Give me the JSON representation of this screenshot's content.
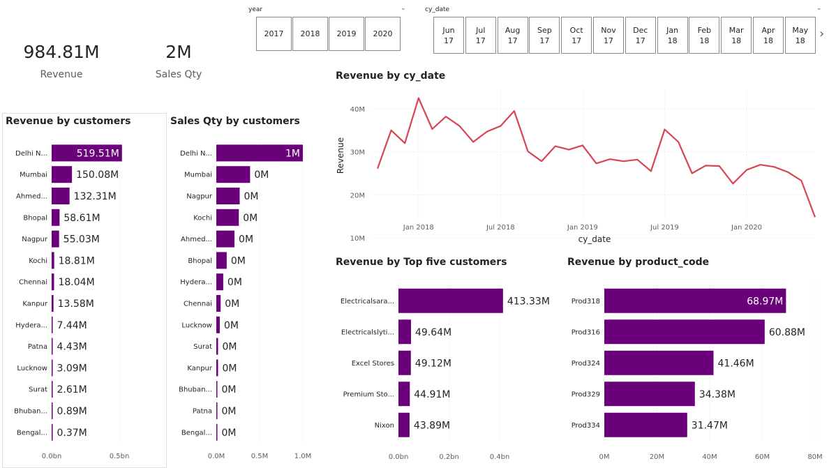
{
  "kpis": [
    {
      "value": "984.81M",
      "label": "Revenue"
    },
    {
      "value": "2M",
      "label": "Sales Qty"
    }
  ],
  "year_slicer": {
    "title": "year",
    "options": [
      "2017",
      "2018",
      "2019",
      "2020"
    ]
  },
  "date_slicer": {
    "title": "cy_date",
    "options": [
      {
        "m": "Jun",
        "y": "17"
      },
      {
        "m": "Jul",
        "y": "17"
      },
      {
        "m": "Aug",
        "y": "17"
      },
      {
        "m": "Sep",
        "y": "17"
      },
      {
        "m": "Oct",
        "y": "17"
      },
      {
        "m": "Nov",
        "y": "17"
      },
      {
        "m": "Dec",
        "y": "17"
      },
      {
        "m": "Jan",
        "y": "18"
      },
      {
        "m": "Feb",
        "y": "18"
      },
      {
        "m": "Mar",
        "y": "18"
      },
      {
        "m": "Apr",
        "y": "18"
      },
      {
        "m": "May",
        "y": "18"
      }
    ]
  },
  "colors": {
    "bar": "#6b007b",
    "line": "#d64550",
    "grid": "#e1dfdd",
    "text": "#252423",
    "axis": "#605e5c"
  },
  "chart_data": [
    {
      "id": "rev_customers",
      "type": "bar",
      "orientation": "horizontal",
      "title": "Revenue by customers",
      "categories": [
        "Delhi N...",
        "Mumbai",
        "Ahmed...",
        "Bhopal",
        "Nagpur",
        "Kochi",
        "Chennai",
        "Kanpur",
        "Hydera...",
        "Patna",
        "Lucknow",
        "Surat",
        "Bhuban...",
        "Bengal..."
      ],
      "values": [
        519.51,
        150.08,
        132.31,
        58.61,
        55.03,
        18.81,
        18.04,
        13.58,
        7.44,
        4.43,
        3.09,
        2.61,
        0.89,
        0.37
      ],
      "data_labels": [
        "519.51M",
        "150.08M",
        "132.31M",
        "58.61M",
        "55.03M",
        "18.81M",
        "18.04M",
        "13.58M",
        "7.44M",
        "4.43M",
        "3.09M",
        "2.61M",
        "0.89M",
        "0.37M"
      ],
      "value_unit": "M",
      "xlim": [
        0,
        500
      ],
      "x_ticks": [
        "0.0bn",
        "0.5bn"
      ],
      "grid": true
    },
    {
      "id": "qty_customers",
      "type": "bar",
      "orientation": "horizontal",
      "title": "Sales Qty by customers",
      "categories": [
        "Delhi N...",
        "Mumbai",
        "Nagpur",
        "Kochi",
        "Ahmed...",
        "Bhopal",
        "Hydera...",
        "Chennai",
        "Lucknow",
        "Surat",
        "Kanpur",
        "Bhuban...",
        "Patna",
        "Bengal..."
      ],
      "values": [
        1.0,
        0.39,
        0.27,
        0.26,
        0.21,
        0.12,
        0.08,
        0.05,
        0.04,
        0.02,
        0.02,
        0.01,
        0.01,
        0.005
      ],
      "data_labels": [
        "1M",
        "0M",
        "0M",
        "0M",
        "0M",
        "0M",
        "0M",
        "0M",
        "0M",
        "0M",
        "0M",
        "0M",
        "0M",
        "0M"
      ],
      "value_unit": "M",
      "xlim": [
        0,
        1.0
      ],
      "x_ticks": [
        "0.0M",
        "0.5M",
        "1.0M"
      ],
      "grid": true
    },
    {
      "id": "rev_date",
      "type": "line",
      "title": "Revenue by cy_date",
      "xlabel": "cy_date",
      "ylabel": "Revenue",
      "x": [
        "2017-10",
        "2017-11",
        "2017-12",
        "2018-01",
        "2018-02",
        "2018-03",
        "2018-04",
        "2018-05",
        "2018-06",
        "2018-07",
        "2018-08",
        "2018-09",
        "2018-10",
        "2018-11",
        "2018-12",
        "2019-01",
        "2019-02",
        "2019-03",
        "2019-04",
        "2019-05",
        "2019-06",
        "2019-07",
        "2019-08",
        "2019-09",
        "2019-10",
        "2019-11",
        "2019-12",
        "2020-01",
        "2020-02",
        "2020-03",
        "2020-04",
        "2020-05",
        "2020-06"
      ],
      "values": [
        26.1,
        35.0,
        32.0,
        42.5,
        35.3,
        38.2,
        36.0,
        32.3,
        34.7,
        36.0,
        39.5,
        30.1,
        27.8,
        31.3,
        30.5,
        31.5,
        27.3,
        28.3,
        27.8,
        28.2,
        25.5,
        35.2,
        32.3,
        25.0,
        26.8,
        26.7,
        22.6,
        25.8,
        27.0,
        26.5,
        25.3,
        23.3,
        14.8
      ],
      "ylim": [
        10,
        40
      ],
      "y_ticks": [
        "10M",
        "20M",
        "30M",
        "40M"
      ],
      "x_ticks": [
        "Jan 2018",
        "Jul 2018",
        "Jan 2019",
        "Jul 2019",
        "Jan 2020"
      ],
      "grid": true
    },
    {
      "id": "rev_top5",
      "type": "bar",
      "orientation": "horizontal",
      "title": "Revenue by Top five customers",
      "categories": [
        "Electricalsara...",
        "Electricalslyti...",
        "Excel Stores",
        "Premium Sto...",
        "Nixon"
      ],
      "values": [
        413.33,
        49.64,
        49.12,
        44.91,
        43.89
      ],
      "data_labels": [
        "413.33M",
        "49.64M",
        "49.12M",
        "44.91M",
        "43.89M"
      ],
      "value_unit": "M",
      "xlim": [
        0,
        400
      ],
      "x_ticks": [
        "0.0bn",
        "0.2bn",
        "0.4bn"
      ],
      "grid": true
    },
    {
      "id": "rev_product",
      "type": "bar",
      "orientation": "horizontal",
      "title": "Revenue by product_code",
      "categories": [
        "Prod318",
        "Prod316",
        "Prod324",
        "Prod329",
        "Prod334"
      ],
      "values": [
        68.97,
        60.88,
        41.46,
        34.38,
        31.47
      ],
      "data_labels": [
        "68.97M",
        "60.88M",
        "41.46M",
        "34.38M",
        "31.47M"
      ],
      "value_unit": "M",
      "xlim": [
        0,
        80
      ],
      "x_ticks": [
        "0M",
        "20M",
        "40M",
        "60M",
        "80M"
      ],
      "grid": true
    }
  ]
}
